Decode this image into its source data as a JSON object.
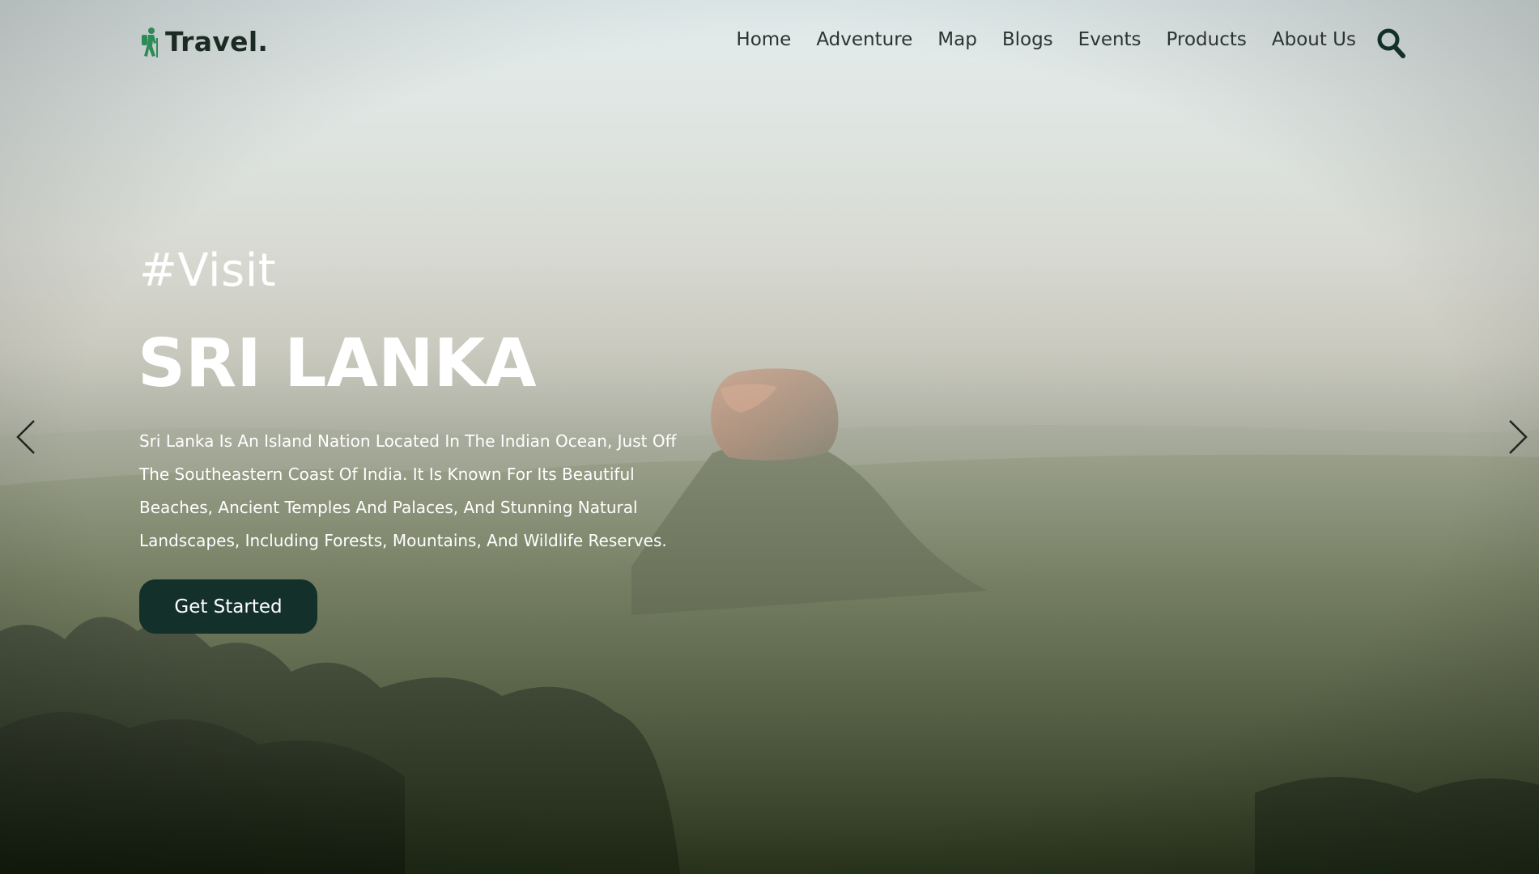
{
  "brand": {
    "name": "Travel.",
    "icon": "hiker-icon",
    "icon_color": "#2e8b57"
  },
  "nav": {
    "items": [
      {
        "label": "Home"
      },
      {
        "label": "Adventure"
      },
      {
        "label": "Map"
      },
      {
        "label": "Blogs"
      },
      {
        "label": "Events"
      },
      {
        "label": "Products"
      },
      {
        "label": "About Us"
      }
    ],
    "search_icon": "search-icon"
  },
  "hero": {
    "hashtag": "#Visit",
    "title": "SRI LANKA",
    "description": "Sri Lanka Is An Island Nation Located In The Indian Ocean, Just Off The Southeastern Coast Of India. It Is Known For Its Beautiful Beaches, Ancient Temples And Palaces, And Stunning Natural Landscapes, Including Forests, Mountains, And Wildlife Reserves.",
    "cta_label": "Get Started",
    "cta_color": "#14302a",
    "prev_icon": "chevron-left-icon",
    "next_icon": "chevron-right-icon"
  },
  "colors": {
    "text_dark": "#1c2a24",
    "text_light": "#ffffff"
  }
}
